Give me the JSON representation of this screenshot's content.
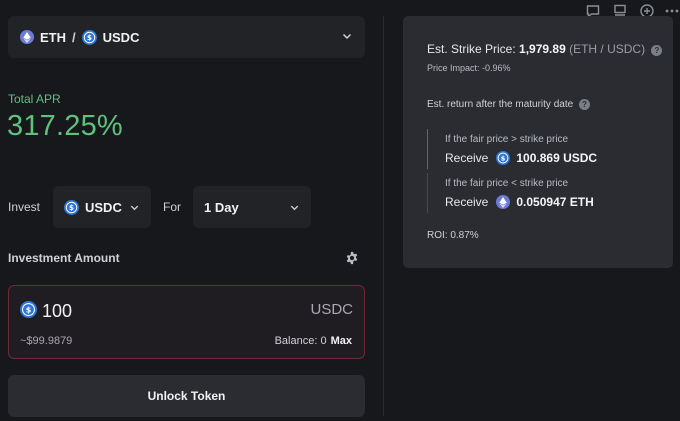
{
  "pair": {
    "base": "ETH",
    "separator": "/",
    "quote": "USDC"
  },
  "apr": {
    "label": "Total APR",
    "value": "317.25%"
  },
  "invest": {
    "label": "Invest",
    "coin": "USDC",
    "for_label": "For",
    "duration": "1 Day"
  },
  "amount": {
    "label": "Investment Amount",
    "value": "100",
    "unit": "USDC",
    "usd_estimate": "~$99.9879",
    "balance_label": "Balance:",
    "balance_value": "0",
    "max_label": "Max"
  },
  "unlock_label": "Unlock Token",
  "panel": {
    "strike_label": "Est. Strike Price:",
    "strike_value": "1,979.89",
    "strike_unit": "(ETH / USDC)",
    "price_impact": "Price Impact: -0.96%",
    "est_return_label": "Est. return after the maturity date",
    "case_up": {
      "condition": "If the fair price > strike price",
      "receive_label": "Receive",
      "amount": "100.869 USDC"
    },
    "case_down": {
      "condition": "If the fair price < strike price",
      "receive_label": "Receive",
      "amount": "0.050947 ETH"
    },
    "roi": "ROI: 0.87%"
  },
  "icons": {
    "toolbar": [
      "chat-bubble-icon",
      "panel-layout-icon",
      "plus-circle-icon",
      "more-dots-icon"
    ],
    "eth": "eth-coin-icon",
    "usdc": "usdc-coin-icon",
    "settings": "gear-icon"
  },
  "colors": {
    "background": "#17181c",
    "card": "#222327",
    "panel": "#2a2c31",
    "apr_green": "#5fc27c",
    "error_border": "#6b2c33",
    "eth": "#6c7bd8",
    "usdc": "#2f77d2"
  }
}
